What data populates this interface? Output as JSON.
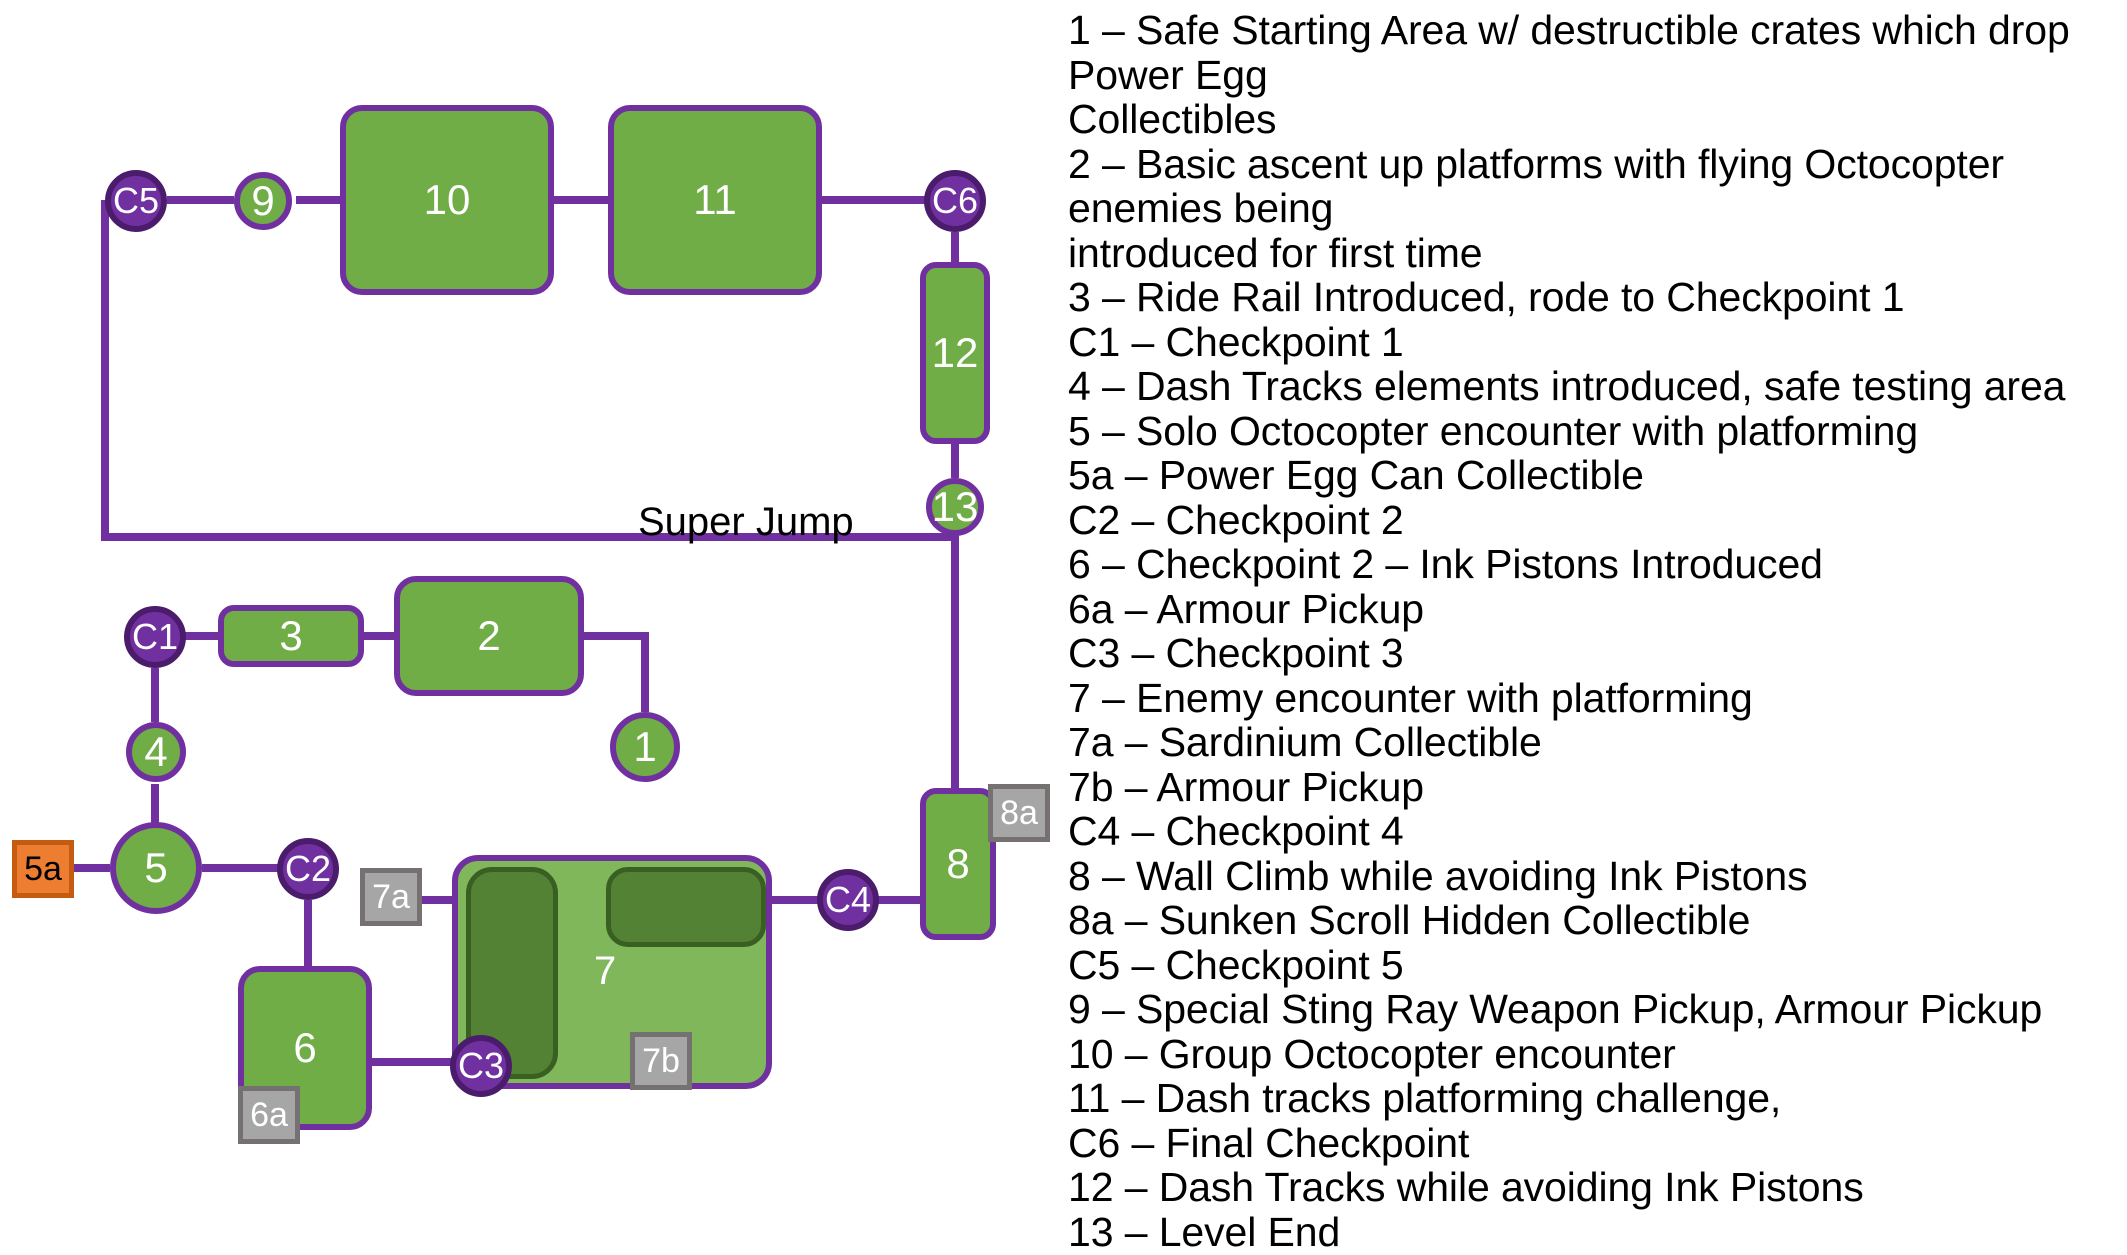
{
  "diagram": {
    "edge_labels": [
      {
        "id": "super-jump",
        "text": "Super Jump"
      }
    ],
    "area7_label": "7",
    "nodes": [
      {
        "id": "c5",
        "label": "C5",
        "kind": "checkpoint"
      },
      {
        "id": "n9",
        "label": "9",
        "kind": "beat"
      },
      {
        "id": "n10",
        "label": "10",
        "kind": "area"
      },
      {
        "id": "n11",
        "label": "11",
        "kind": "area"
      },
      {
        "id": "c6",
        "label": "C6",
        "kind": "checkpoint"
      },
      {
        "id": "n12",
        "label": "12",
        "kind": "area"
      },
      {
        "id": "n13",
        "label": "13",
        "kind": "beat"
      },
      {
        "id": "c1",
        "label": "C1",
        "kind": "checkpoint"
      },
      {
        "id": "n3",
        "label": "3",
        "kind": "area"
      },
      {
        "id": "n2",
        "label": "2",
        "kind": "area"
      },
      {
        "id": "n1",
        "label": "1",
        "kind": "beat"
      },
      {
        "id": "n4",
        "label": "4",
        "kind": "beat"
      },
      {
        "id": "n5",
        "label": "5",
        "kind": "beat"
      },
      {
        "id": "n5a",
        "label": "5a",
        "kind": "collectible-orange"
      },
      {
        "id": "c2",
        "label": "C2",
        "kind": "checkpoint"
      },
      {
        "id": "n6",
        "label": "6",
        "kind": "area"
      },
      {
        "id": "n6a",
        "label": "6a",
        "kind": "pickup"
      },
      {
        "id": "n7a",
        "label": "7a",
        "kind": "pickup"
      },
      {
        "id": "c3",
        "label": "C3",
        "kind": "checkpoint"
      },
      {
        "id": "n7b",
        "label": "7b",
        "kind": "pickup"
      },
      {
        "id": "c4",
        "label": "C4",
        "kind": "checkpoint"
      },
      {
        "id": "n8",
        "label": "8",
        "kind": "area"
      },
      {
        "id": "n8a",
        "label": "8a",
        "kind": "pickup"
      }
    ]
  },
  "legend": {
    "lines": [
      "1 – Safe Starting Area w/ destructible crates which drop Power Egg",
      "Collectibles",
      "2 – Basic ascent up platforms with flying Octocopter enemies being",
      "introduced for first time",
      "3 – Ride Rail Introduced, rode to Checkpoint 1",
      "C1 – Checkpoint 1",
      "4 – Dash Tracks elements introduced, safe testing area",
      "5 – Solo Octocopter encounter with platforming",
      "5a – Power Egg Can Collectible",
      "C2 – Checkpoint 2",
      "6 – Checkpoint 2 – Ink Pistons Introduced",
      "6a – Armour Pickup",
      "C3 – Checkpoint 3",
      "7 – Enemy encounter with platforming",
      "7a – Sardinium Collectible",
      "7b – Armour Pickup",
      "C4 – Checkpoint 4",
      "8 – Wall Climb while avoiding Ink Pistons",
      "8a – Sunken Scroll Hidden Collectible",
      "C5 – Checkpoint 5",
      "9 – Special Sting Ray Weapon Pickup, Armour Pickup",
      "10 – Group Octocopter encounter",
      "11 – Dash tracks platforming challenge,",
      "C6 – Final Checkpoint",
      "12 – Dash Tracks while avoiding Ink Pistons",
      "13 – Level End"
    ]
  },
  "colors": {
    "area_fill": "#70AD47",
    "area_fill_light": "#7FB75A",
    "subregion_fill": "#548235",
    "edge_purple": "#7030A0",
    "checkpoint_fill": "#7030A0",
    "checkpoint_border": "#4B1C6B",
    "pickup_fill": "#A6A6A6",
    "pickup_border": "#767171",
    "collectible_fill": "#ED7D31",
    "collectible_border": "#C55A11",
    "background": "#FFFFFF",
    "text_light": "#FFFFFF",
    "text_dark": "#000000"
  }
}
